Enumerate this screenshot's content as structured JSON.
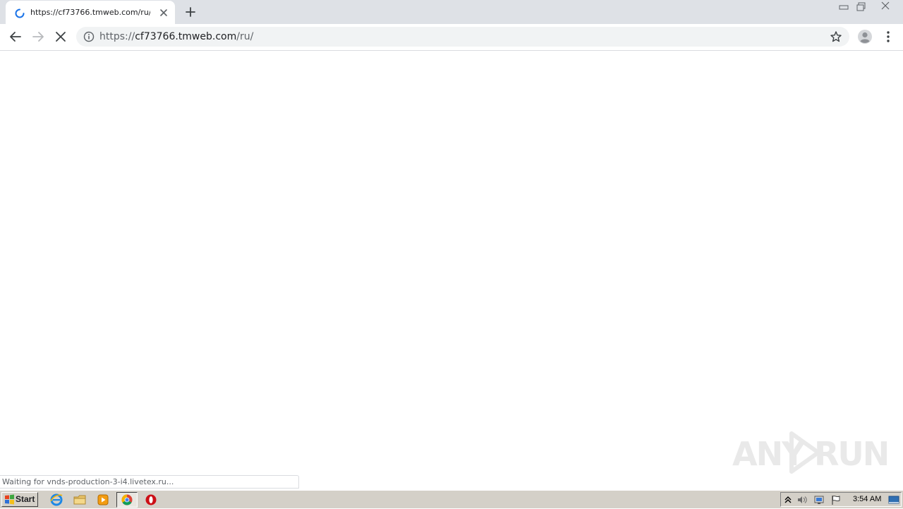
{
  "browser": {
    "tab": {
      "title": "https://cf73766.tmweb.com/ru/",
      "state": "loading"
    },
    "omnibox": {
      "scheme": "https://",
      "host": "cf73766.tmweb.com",
      "path": "/ru/"
    },
    "status_text": "Waiting for vnds-production-3-i4.livetex.ru...",
    "accent_color": "#1a73e8"
  },
  "watermark": {
    "left": "ANY",
    "right": "RUN"
  },
  "taskbar": {
    "start_label": "Start",
    "clock": "3:54 AM",
    "quick_launch": [
      "internet-explorer-icon",
      "file-explorer-icon",
      "media-player-icon",
      "chrome-icon",
      "opera-icon"
    ]
  }
}
